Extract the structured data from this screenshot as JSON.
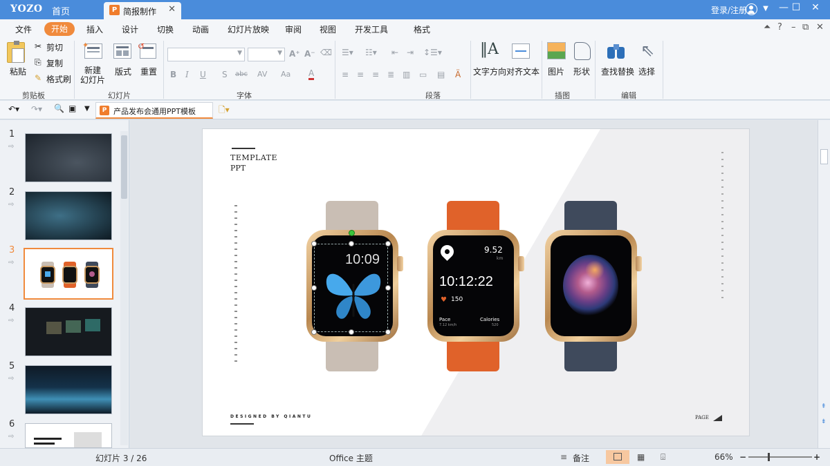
{
  "app": {
    "logo": "YOZO",
    "home_tab": "首页",
    "doc_tab": "简报制作",
    "doc_tab_icon": "P",
    "login": "登录/注册"
  },
  "window_controls": {
    "dropdown": "▼",
    "minimize": "—",
    "maximize": "☐",
    "close": "✕"
  },
  "menu": {
    "items": [
      "文件",
      "开始",
      "插入",
      "设计",
      "切换",
      "动画",
      "幻灯片放映",
      "审阅",
      "视图",
      "开发工具",
      "格式"
    ],
    "active": "开始",
    "right": [
      "⏶",
      "?",
      "–",
      "⧉",
      "✕"
    ]
  },
  "ribbon": {
    "clipboard": {
      "label": "剪贴板",
      "paste": "粘贴",
      "cut": "剪切",
      "copy": "复制",
      "format_painter": "格式刷"
    },
    "slides": {
      "label": "幻灯片",
      "new_slide": "新建\n幻灯片",
      "layout": "版式",
      "reset": "重置"
    },
    "font": {
      "label": "字体",
      "font_name": "",
      "font_size": "",
      "bold": "B",
      "italic": "I",
      "underline": "U",
      "shadow": "S",
      "strike": "abc",
      "spacing": "AV",
      "case": "Aa",
      "color": "A",
      "grow": "A⁺",
      "shrink": "A⁻"
    },
    "paragraph": {
      "label": "段落"
    },
    "text_direction": "文字方向",
    "align_text": "对齐文本",
    "drawing": {
      "label": "插图",
      "picture": "图片",
      "shape": "形状"
    },
    "editing": {
      "label": "编辑",
      "find_replace": "查找替换",
      "select": "选择"
    }
  },
  "quickbar": {
    "file_tab": "产品发布会通用PPT模板",
    "file_tab_icon": "P"
  },
  "thumbnails": {
    "numbers": [
      "1",
      "2",
      "3",
      "4",
      "5",
      "6"
    ],
    "selected": "3"
  },
  "slide": {
    "template": "TEMPLATE",
    "ppt": "PPT",
    "footer": "DESIGNED BY QIANTU",
    "page": "PAGE",
    "watch1": {
      "time": "10:09"
    },
    "watch2": {
      "distance": "9.52",
      "distance_unit": "km",
      "time": "10:12:22",
      "heart_rate": "150",
      "pace_label": "Pace",
      "pace_value": "7.12 km/h",
      "calories_label": "Calories",
      "calories_value": "520"
    }
  },
  "status": {
    "slide_info": "幻灯片 3 / 26",
    "theme": "Office 主题",
    "notes": "备注",
    "zoom": "66%",
    "zoom_minus": "−",
    "zoom_plus": "+"
  },
  "colors": {
    "titlebar": "#4a8cdb",
    "accent": "#f08a3c",
    "strap1": "#c9beb4",
    "strap2": "#e0622a",
    "strap3": "#3f4a5c"
  }
}
